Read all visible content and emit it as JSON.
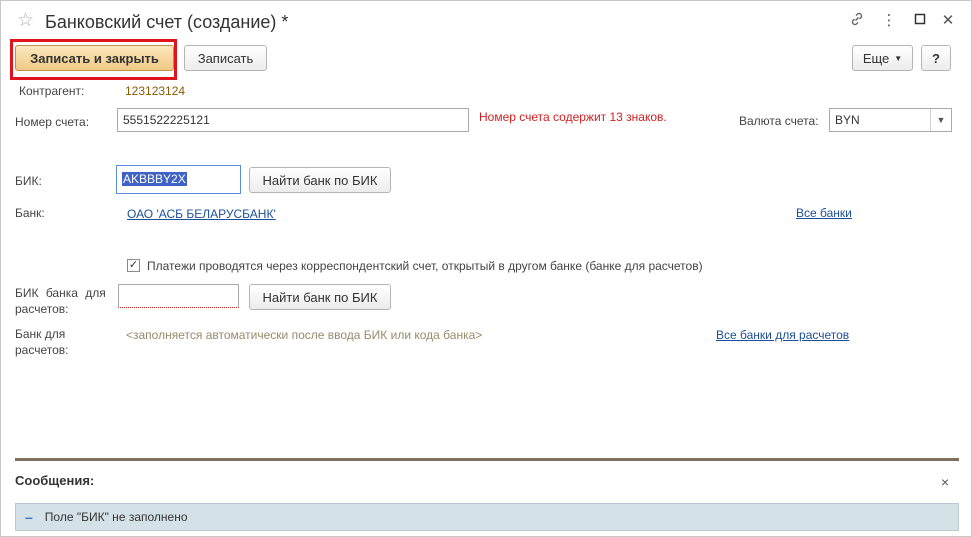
{
  "window": {
    "title": "Банковский счет (создание) *",
    "icons": [
      "star-icon",
      "link-icon",
      "more-icon",
      "maximize-icon",
      "close-icon"
    ]
  },
  "toolbar": {
    "save_close_label": "Записать и закрыть",
    "save_label": "Записать",
    "more_label": "Еще",
    "help_label": "?"
  },
  "form": {
    "counterparty_label": "Контрагент:",
    "counterparty_value": "123123124",
    "account_number_label": "Номер счета:",
    "account_number_value": "5551522225121",
    "account_number_error": "Номер счета содержит 13 знаков.",
    "currency_label": "Валюта счета:",
    "currency_value": "BYN",
    "bik_label": "БИК:",
    "bik_value": "AKBBBY2X",
    "find_bank_label": "Найти банк по БИК",
    "bank_label": "Банк:",
    "bank_value": "ОАО 'АСБ БЕЛАРУСБАНК'",
    "all_banks_link": "Все банки",
    "correspondent_checkbox_label": "Платежи проводятся через корреспондентский счет, открытый в другом банке (банке для расчетов)",
    "correspondent_checked": true,
    "settlement_bik_label_1": "БИК банка для",
    "settlement_bik_label_2": "расчетов:",
    "settlement_bik_value": "",
    "settlement_find_bank_label": "Найти банк по БИК",
    "settlement_bank_label_1": "Банк для",
    "settlement_bank_label_2": "расчетов:",
    "settlement_bank_hint": "<заполняется автоматически после ввода БИК или кода банка>",
    "all_settlement_banks_link": "Все банки для расчетов"
  },
  "messages": {
    "title": "Сообщения:",
    "items": [
      "Поле \"БИК\" не заполнено"
    ]
  },
  "colors": {
    "primary_button": "#f1c985",
    "error_text": "#d21f1f",
    "link": "#1b4f9a",
    "highlight_frame": "#e0141d",
    "message_bg": "#d4e1e7"
  }
}
